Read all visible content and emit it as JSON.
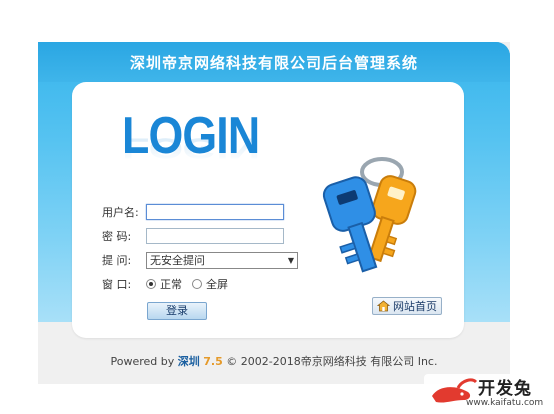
{
  "header": {
    "title": "深圳帝京网络科技有限公司后台管理系统"
  },
  "banner": {
    "login_word": "LOGIN"
  },
  "form": {
    "username_label": "用户名:",
    "username_value": "",
    "password_label": "密 码:",
    "password_value": "",
    "question_label": "提 问:",
    "question_selected": "无安全提问",
    "window_label": "窗 口:",
    "window_options": [
      {
        "label": "正常",
        "selected": true
      },
      {
        "label": "全屏",
        "selected": false
      }
    ],
    "login_button": "登录"
  },
  "home_button": {
    "label": "网站首页",
    "icon": "house-icon"
  },
  "footer": {
    "powered_by": "Powered by",
    "brand": "深圳",
    "version": "7.5",
    "copyright": "© 2002-2018帝京网络科技 有限公司 Inc."
  },
  "watermark": {
    "title": "开发兔",
    "url": "www.kaifatu.com"
  },
  "colors": {
    "accent_blue": "#35b4ec",
    "login_blue": "#1a86d6",
    "version_orange": "#e59a2a"
  }
}
